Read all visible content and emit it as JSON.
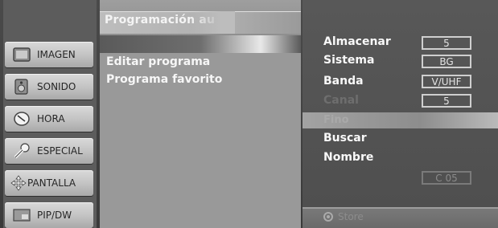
{
  "menu": {
    "items": [
      {
        "label": "IMAGEN",
        "icon": "picture-icon"
      },
      {
        "label": "SONIDO",
        "icon": "speaker-icon"
      },
      {
        "label": "HORA",
        "icon": "clock-icon"
      },
      {
        "label": "ESPECIAL",
        "icon": "key-icon"
      },
      {
        "label": "PANTALLA",
        "icon": "move-arrows-icon"
      },
      {
        "label": "PIP/DW",
        "icon": "pip-icon"
      }
    ]
  },
  "program_menu": {
    "title": "Programación au",
    "items": [
      "Editar programa",
      "Programa favorito"
    ]
  },
  "settings": {
    "almacenar": {
      "label": "Almacenar",
      "value": "5"
    },
    "sistema": {
      "label": "Sistema",
      "value": "BG"
    },
    "banda": {
      "label": "Banda",
      "value": "V/UHF"
    },
    "canal": {
      "label": "Canal",
      "value": "5"
    },
    "fino": {
      "label": "Fino"
    },
    "buscar": {
      "label": "Buscar"
    },
    "nombre": {
      "label": "Nombre",
      "value": "C 05"
    },
    "store": {
      "label": "Store"
    }
  }
}
